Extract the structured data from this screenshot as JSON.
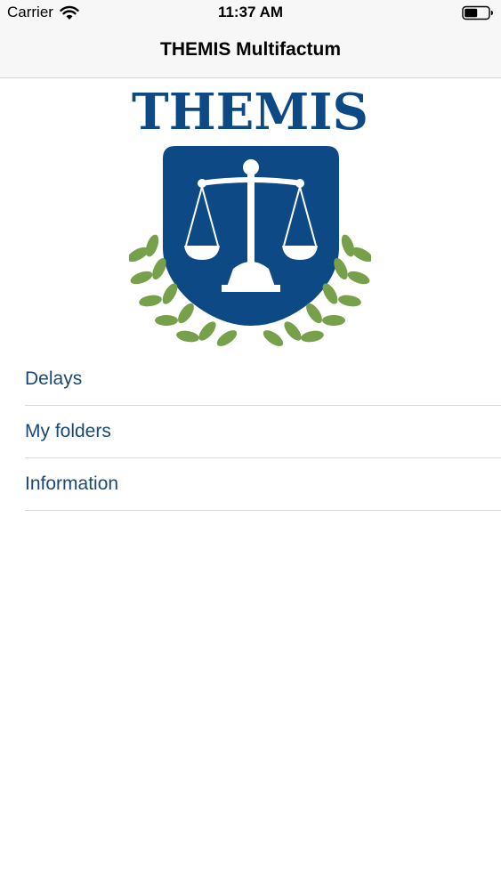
{
  "status_bar": {
    "carrier": "Carrier",
    "time": "11:37 AM",
    "wifi_icon": "wifi-icon",
    "battery_icon": "battery-icon"
  },
  "nav": {
    "title": "THEMIS Multifactum"
  },
  "logo": {
    "text": "THEMIS",
    "brand_color": "#0d4a85",
    "laurel_color": "#76a04a",
    "icon": "scales-of-justice-icon"
  },
  "menu": {
    "items": [
      {
        "label": "Delays"
      },
      {
        "label": "My folders"
      },
      {
        "label": "Information"
      }
    ],
    "link_color": "#174877"
  }
}
